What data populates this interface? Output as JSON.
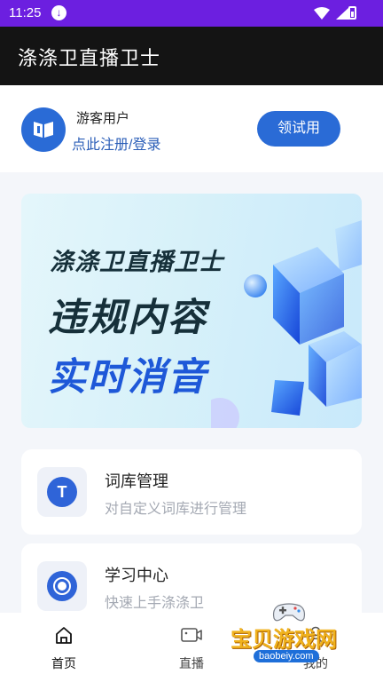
{
  "status_bar": {
    "time": "11:25"
  },
  "app_bar": {
    "title": "涤涤卫直播卫士"
  },
  "user": {
    "name": "游客用户",
    "login_link": "点此注册/登录",
    "trial_button": "领试用"
  },
  "banner": {
    "line1": "涤涤卫直播卫士",
    "line2": "违规内容",
    "line3": "实时消音"
  },
  "features": [
    {
      "title": "词库管理",
      "desc": "对自定义词库进行管理",
      "icon": "T"
    },
    {
      "title": "学习中心",
      "desc": "快速上手涤涤卫"
    }
  ],
  "nav": {
    "home": "首页",
    "live": "直播",
    "mine": "我的"
  },
  "watermark": {
    "text": "宝贝游戏网",
    "url": "baobeiy.com"
  },
  "colors": {
    "accent": "#2a6bd6",
    "status_bar": "#6c1fe0",
    "app_bar": "#141414"
  }
}
